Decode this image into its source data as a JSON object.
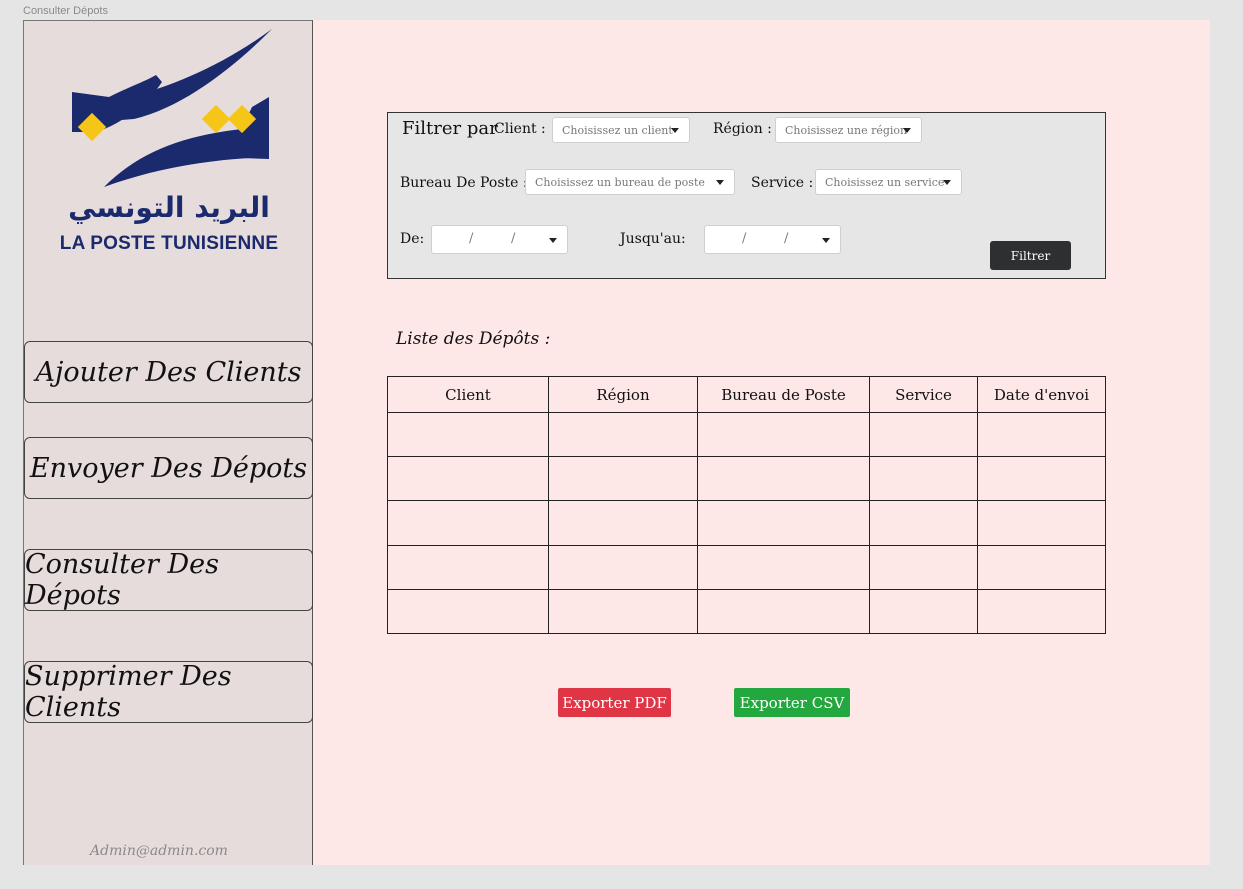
{
  "frame_label": "Consulter Dépots",
  "brand": {
    "arabic_name": "البريد التونسي",
    "french_name": "LA POSTE TUNISIENNE",
    "navy": "#1a2a6c",
    "gold": "#f5c518"
  },
  "sidebar": {
    "items": [
      {
        "label": "Ajouter Des Clients"
      },
      {
        "label": "Envoyer Des Dépots"
      },
      {
        "label": "Consulter Des Dépots"
      },
      {
        "label": "Supprimer Des Clients"
      }
    ],
    "user_email": "Admin@admin.com"
  },
  "filters": {
    "title": "Filtrer par",
    "client_label": "Client :",
    "client_placeholder": "Choisissez un client",
    "region_label": "Région :",
    "region_placeholder": "Choisissez une région",
    "bureau_label": "Bureau De Poste :",
    "bureau_placeholder": "Choisissez un bureau de poste",
    "service_label": "Service :",
    "service_placeholder": "Choisissez un service",
    "from_label": "De:",
    "to_label": "Jusqu'au:",
    "date_separator": "/",
    "submit_label": "Filtrer"
  },
  "list": {
    "title": "Liste des Dépôts :",
    "columns": [
      "Client",
      "Région",
      "Bureau de Poste",
      "Service",
      "Date d'envoi"
    ],
    "rows": [
      [
        "",
        "",
        "",
        "",
        ""
      ],
      [
        "",
        "",
        "",
        "",
        ""
      ],
      [
        "",
        "",
        "",
        "",
        ""
      ],
      [
        "",
        "",
        "",
        "",
        ""
      ],
      [
        "",
        "",
        "",
        "",
        ""
      ]
    ]
  },
  "actions": {
    "export_pdf_label": "Exporter PDF",
    "export_csv_label": "Exporter CSV",
    "pdf_color": "#e03545",
    "csv_color": "#23a73f"
  }
}
